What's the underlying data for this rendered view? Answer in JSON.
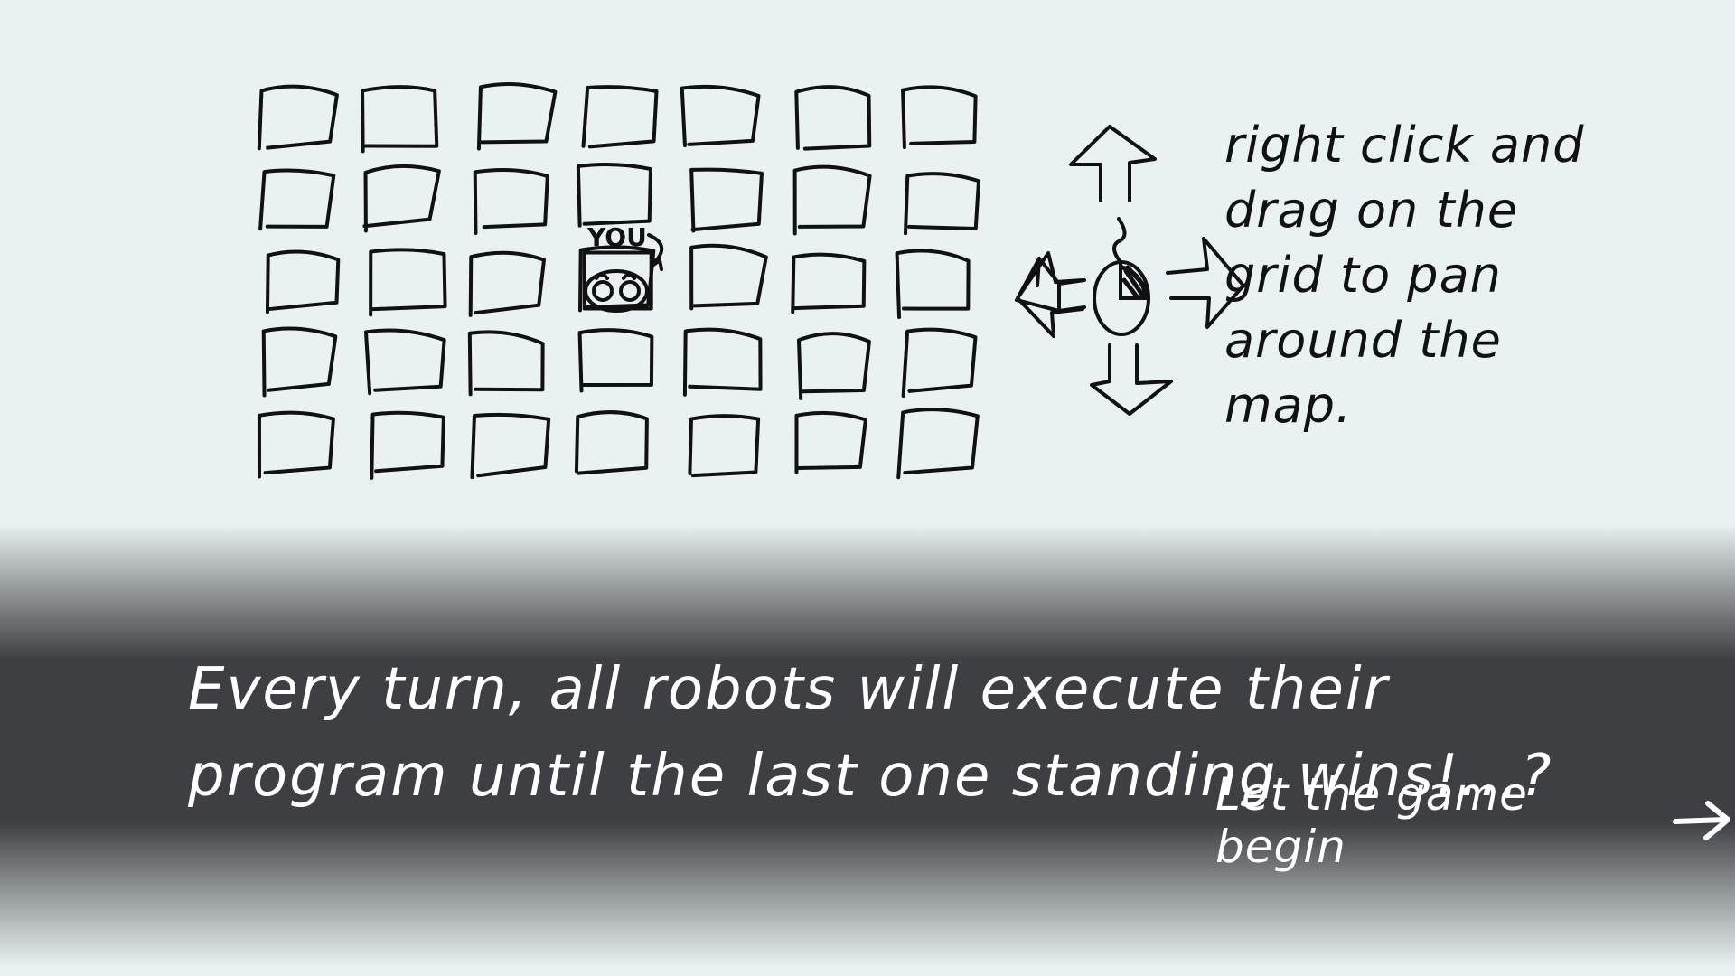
{
  "tutorial": {
    "grid": {
      "rows": 5,
      "cols": 7,
      "player_row": 2,
      "player_col": 3
    },
    "player_label": "YOU",
    "pan_hint": "right click and drag on the grid to pan around the map.",
    "message": "Every turn, all robots will execute their program until the last one standing wins!...?",
    "continue_label": "Let the game begin"
  },
  "colors": {
    "background": "#e9f1f3",
    "ink": "#111111",
    "banner": "#3e3f42",
    "banner_text": "#ffffff"
  },
  "icons": [
    "mouse-icon",
    "arrow-up-icon",
    "arrow-down-icon",
    "arrow-left-icon",
    "arrow-right-icon",
    "robot-icon"
  ]
}
